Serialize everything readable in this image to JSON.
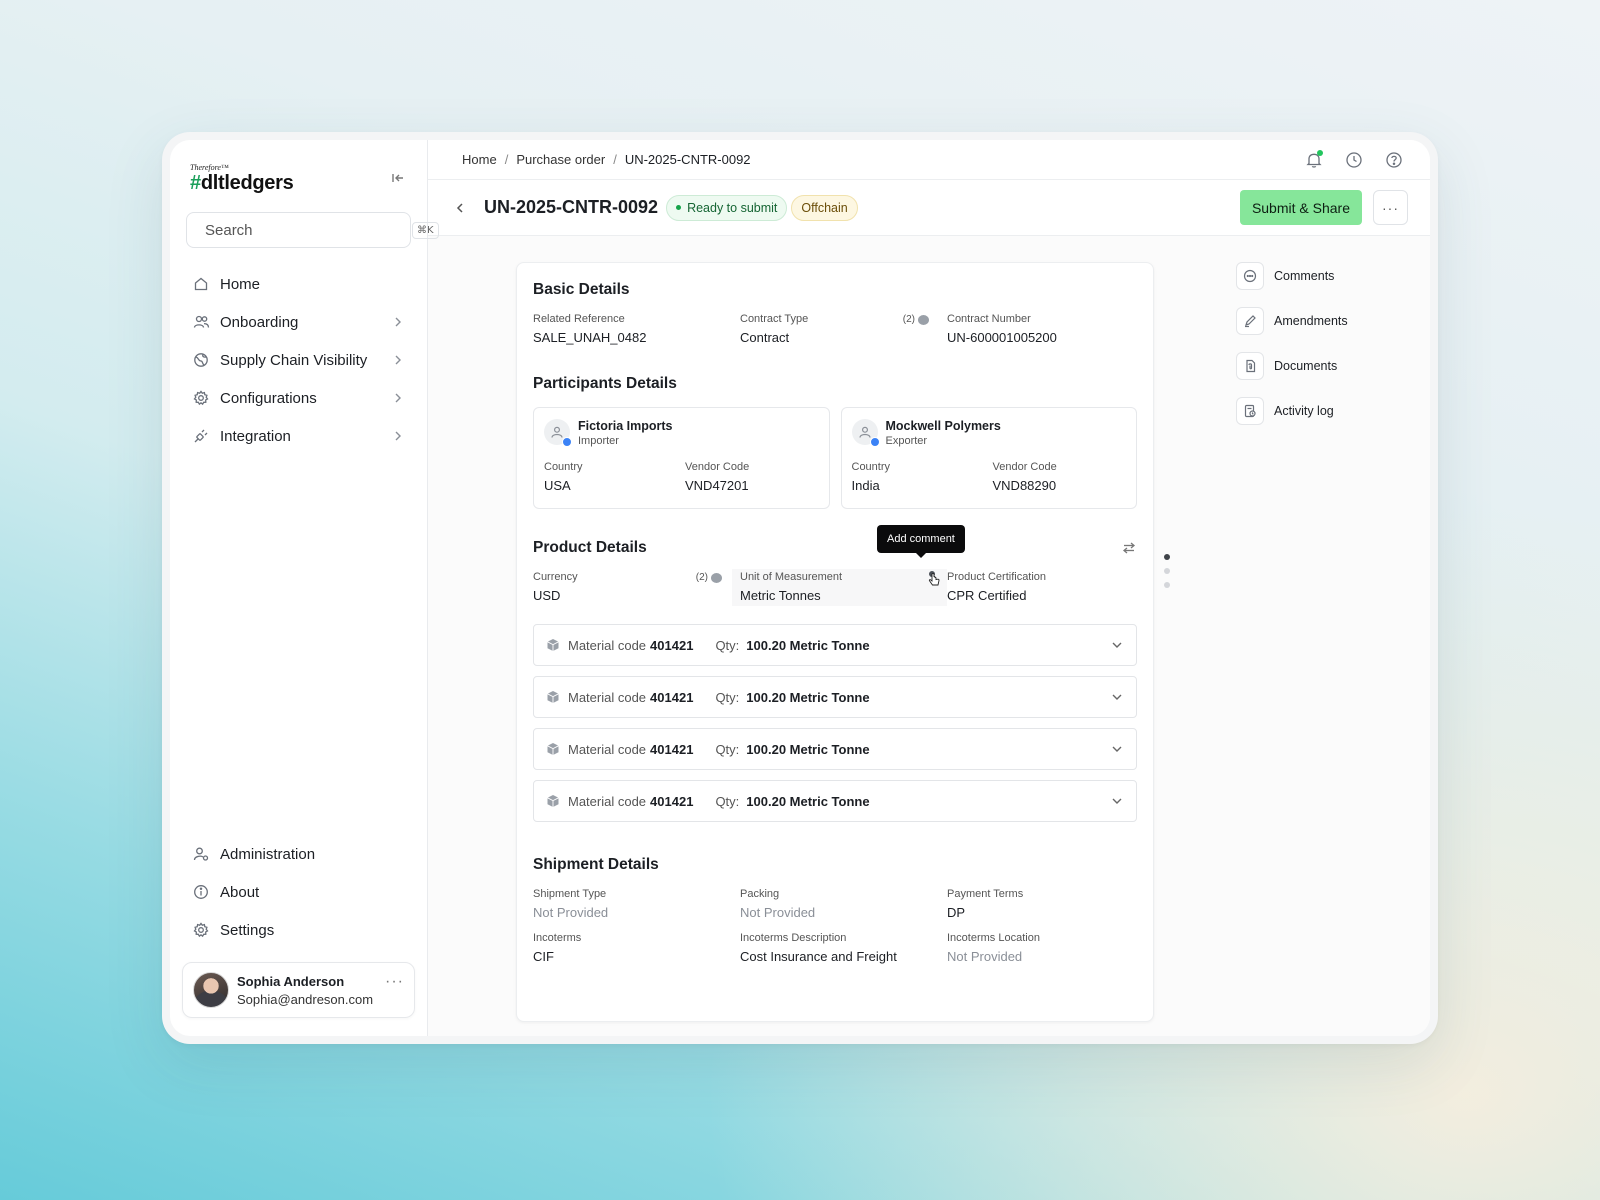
{
  "brand": {
    "tagline": "Therefore™",
    "hash": "#",
    "name": "dltledgers"
  },
  "search": {
    "placeholder": "Search",
    "shortcut": "⌘K"
  },
  "nav": {
    "items": [
      {
        "label": "Home",
        "icon": "home-icon"
      },
      {
        "label": "Onboarding",
        "icon": "users-icon"
      },
      {
        "label": "Supply Chain Visibility",
        "icon": "globe-icon"
      },
      {
        "label": "Configurations",
        "icon": "gear-icon"
      },
      {
        "label": "Integration",
        "icon": "plug-icon"
      }
    ],
    "bottom": [
      {
        "label": "Administration",
        "icon": "user-gear-icon"
      },
      {
        "label": "About",
        "icon": "info-icon"
      },
      {
        "label": "Settings",
        "icon": "settings-icon"
      }
    ]
  },
  "user": {
    "name": "Sophia Anderson",
    "email": "Sophia@andreson.com"
  },
  "breadcrumb": {
    "home": "Home",
    "section": "Purchase order",
    "current": "UN-2025-CNTR-0092"
  },
  "header": {
    "title": "UN-2025-CNTR-0092",
    "status": "Ready to submit",
    "tag": "Offchain",
    "submit_label": "Submit & Share",
    "more_label": "···"
  },
  "basic": {
    "title": "Basic Details",
    "related_reference": {
      "label": "Related Reference",
      "value": "SALE_UNAH_0482"
    },
    "contract_type": {
      "label": "Contract Type",
      "value": "Contract",
      "comments": "(2)"
    },
    "contract_number": {
      "label": "Contract Number",
      "value": "UN-600001005200"
    }
  },
  "participants": {
    "title": "Participants Details",
    "items": [
      {
        "name": "Fictoria Imports",
        "role": "Importer",
        "country_label": "Country",
        "country": "USA",
        "vendor_label": "Vendor Code",
        "vendor": "VND47201"
      },
      {
        "name": "Mockwell Polymers",
        "role": "Exporter",
        "country_label": "Country",
        "country": "India",
        "vendor_label": "Vendor Code",
        "vendor": "VND88290"
      }
    ]
  },
  "product": {
    "title": "Product Details",
    "tooltip": "Add comment",
    "currency": {
      "label": "Currency",
      "value": "USD",
      "comments": "(2)"
    },
    "uom": {
      "label": "Unit of Measurement",
      "value": "Metric Tonnes"
    },
    "certification": {
      "label": "Product Certification",
      "value": "CPR Certified"
    },
    "materials": [
      {
        "label": "Material code",
        "code": "401421",
        "qty_label": "Qty:",
        "qty": "100.20 Metric Tonne"
      },
      {
        "label": "Material code",
        "code": "401421",
        "qty_label": "Qty:",
        "qty": "100.20 Metric Tonne"
      },
      {
        "label": "Material code",
        "code": "401421",
        "qty_label": "Qty:",
        "qty": "100.20 Metric Tonne"
      },
      {
        "label": "Material code",
        "code": "401421",
        "qty_label": "Qty:",
        "qty": "100.20 Metric Tonne"
      }
    ]
  },
  "shipment": {
    "title": "Shipment Details",
    "shipment_type": {
      "label": "Shipment Type",
      "value": "Not Provided"
    },
    "packing": {
      "label": "Packing",
      "value": "Not Provided"
    },
    "payment_terms": {
      "label": "Payment Terms",
      "value": "DP"
    },
    "incoterms": {
      "label": "Incoterms",
      "value": "CIF"
    },
    "incoterms_description": {
      "label": "Incoterms Description",
      "value": "Cost Insurance and Freight"
    },
    "incoterms_location": {
      "label": "Incoterms Location",
      "value": "Not Provided"
    }
  },
  "side_actions": [
    {
      "label": "Comments",
      "icon": "comment-icon"
    },
    {
      "label": "Amendments",
      "icon": "pen-icon"
    },
    {
      "label": "Documents",
      "icon": "document-icon"
    },
    {
      "label": "Activity log",
      "icon": "activity-icon"
    }
  ],
  "pager": {
    "pages": 3,
    "active_page": 1
  },
  "colors": {
    "primary_button": "#86e69a",
    "status_green": "#16a34a",
    "offchain_bg": "#fdf7e2",
    "brand_hash": "#1b9f5a"
  }
}
